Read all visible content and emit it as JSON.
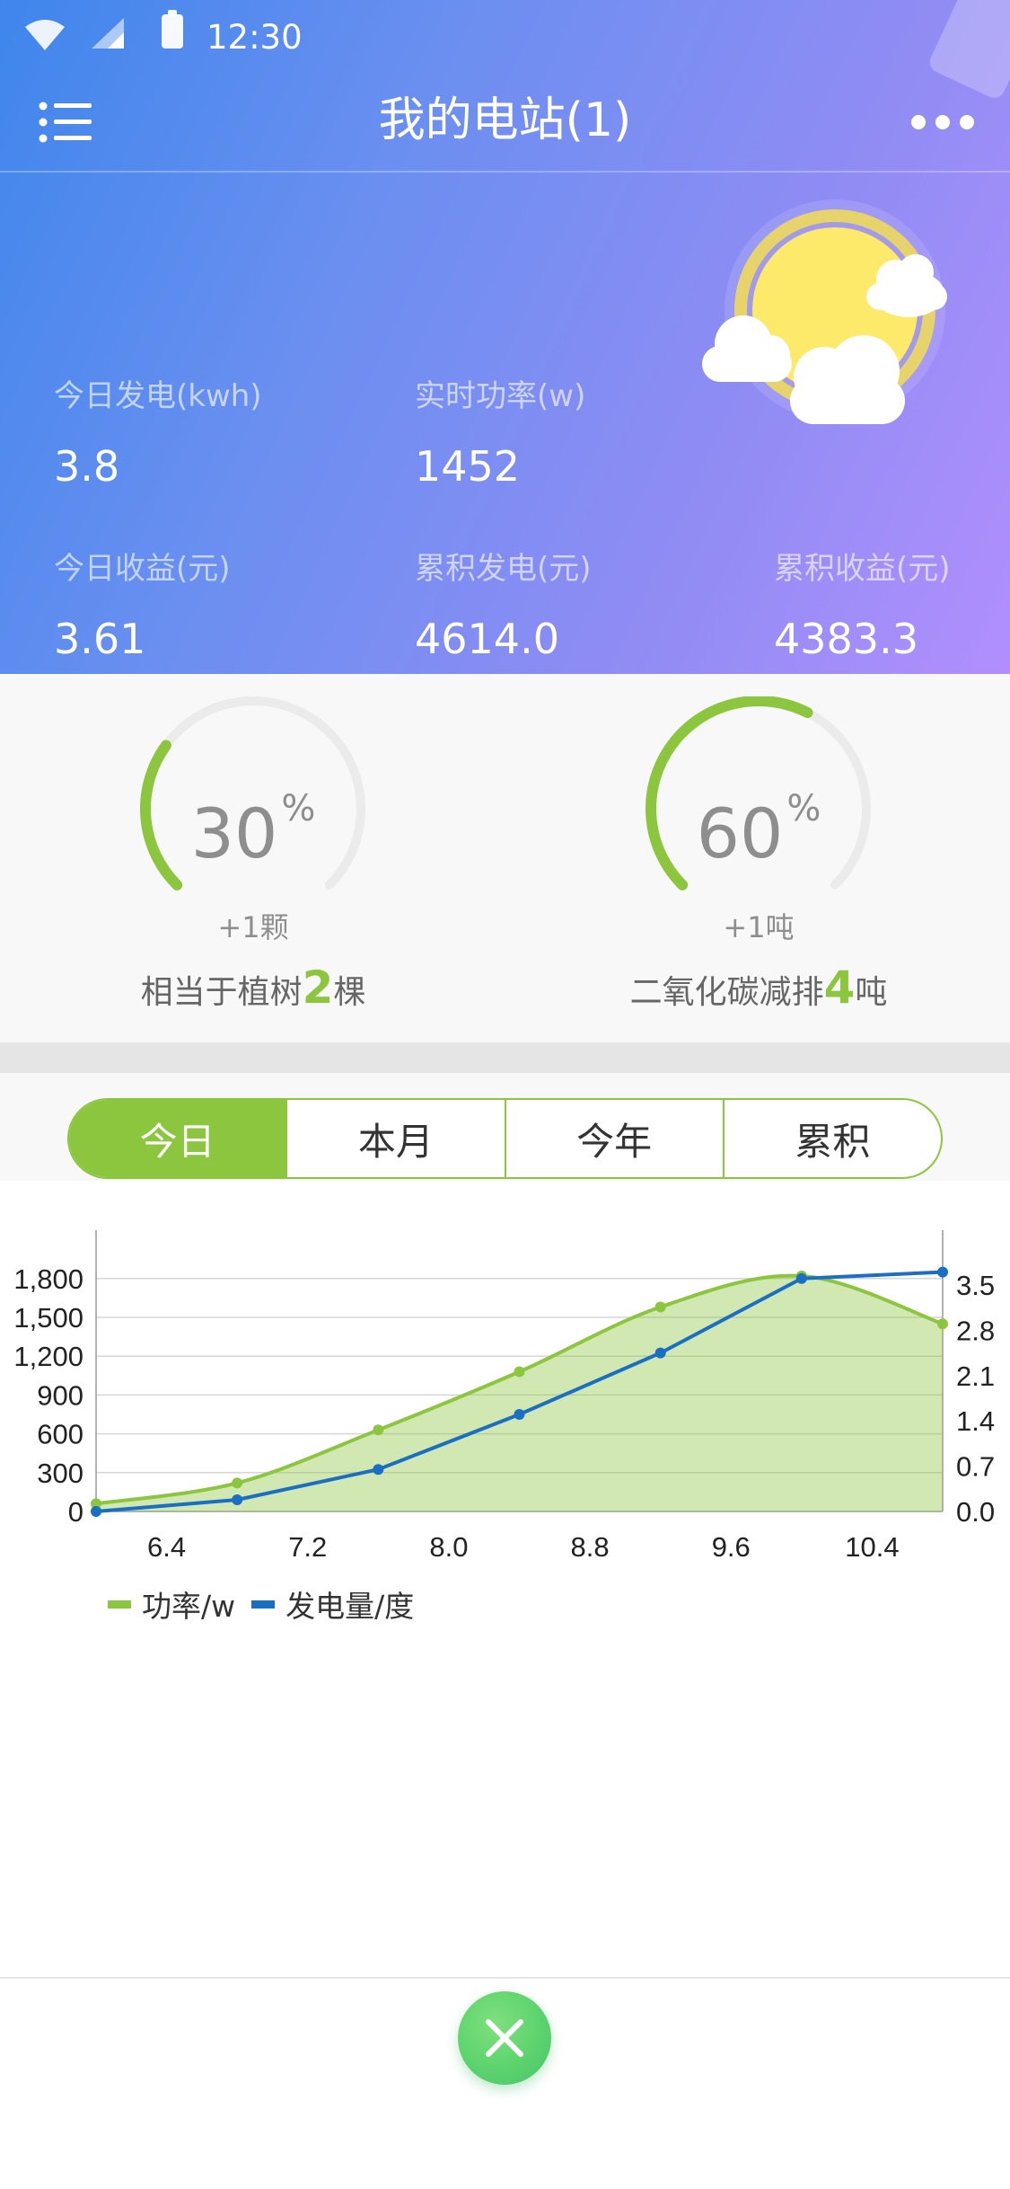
{
  "status_bar": {
    "time": "12:30"
  },
  "nav": {
    "title": "我的电站(1)"
  },
  "stats": [
    {
      "label": "今日发电(kwh)",
      "value": "3.8"
    },
    {
      "label": "实时功率(w)",
      "value": "1452"
    },
    {
      "label": "今日收益(元)",
      "value": "3.61"
    },
    {
      "label": "累积发电(元)",
      "value": "4614.0"
    },
    {
      "label": "累积收益(元)",
      "value": "4383.3"
    }
  ],
  "gauges": [
    {
      "percent_num": "30",
      "percent_sign": "%",
      "sub": "+1颗",
      "progress": 0.3,
      "caption_pre": "相当于植树",
      "caption_value": "2",
      "caption_post": "棵"
    },
    {
      "percent_num": "60",
      "percent_sign": "%",
      "sub": "+1吨",
      "progress": 0.6,
      "caption_pre": "二氧化碳减排",
      "caption_value": "4",
      "caption_post": "吨"
    }
  ],
  "colors": {
    "accent": "#8cc63f",
    "line_blue": "#1a6fc4",
    "track": "#ebebeb"
  },
  "tabs": [
    {
      "label": "今日",
      "active": true
    },
    {
      "label": "本月",
      "active": false
    },
    {
      "label": "今年",
      "active": false
    },
    {
      "label": "累积",
      "active": false
    }
  ],
  "icons": {
    "menu": "list-menu-icon",
    "more": "more-dots-icon",
    "close": "close-icon",
    "weather": "sun-cloud-icon"
  },
  "chart_data": {
    "type": "line",
    "x": [
      6.0,
      6.8,
      7.6,
      8.4,
      9.2,
      10.0,
      10.8
    ],
    "xticks": [
      "6.4",
      "7.2",
      "8.0",
      "8.8",
      "9.6",
      "10.4"
    ],
    "xlim": [
      6.0,
      10.8
    ],
    "series": [
      {
        "name": "功率/w",
        "axis": "left",
        "color": "#8cc63f",
        "fill": true,
        "values": [
          60,
          220,
          630,
          1080,
          1580,
          1820,
          1450
        ]
      },
      {
        "name": "发电量/度",
        "axis": "right",
        "color": "#1a6fc4",
        "fill": false,
        "values": [
          0.0,
          0.18,
          0.65,
          1.5,
          2.45,
          3.6,
          3.7
        ]
      }
    ],
    "y_left": {
      "ticks": [
        "0",
        "300",
        "600",
        "900",
        "1,200",
        "1,500",
        "1,800"
      ],
      "ylim": [
        0,
        2000
      ]
    },
    "y_right": {
      "ticks": [
        "0.0",
        "0.7",
        "1.4",
        "2.1",
        "2.8",
        "3.5"
      ],
      "ylim": [
        0,
        4.0
      ]
    },
    "grid": true,
    "legend": "bottom-left"
  }
}
